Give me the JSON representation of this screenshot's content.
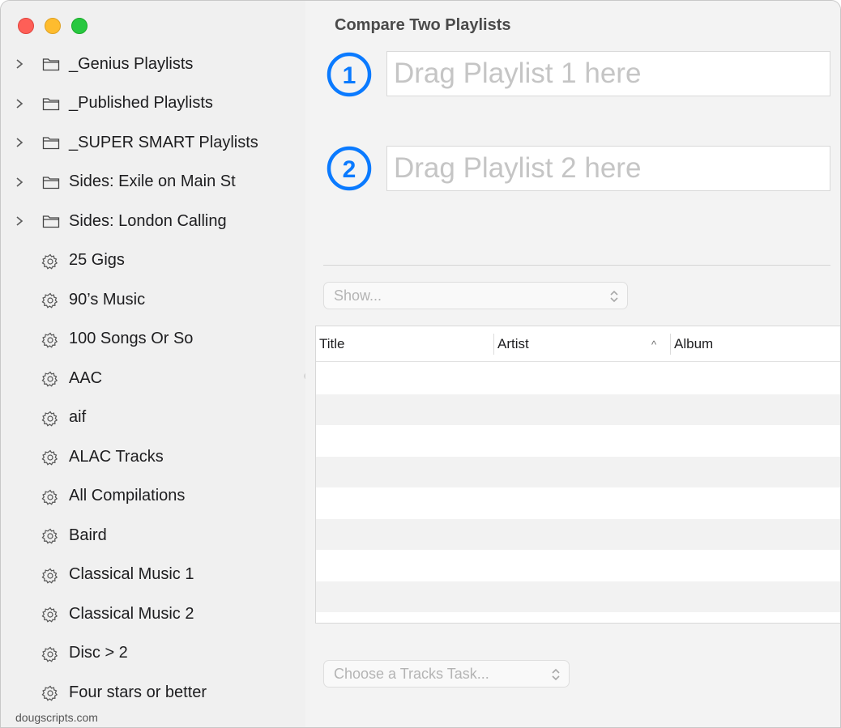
{
  "window": {
    "title": "Compare Two Playlists"
  },
  "sidebar": {
    "items": [
      {
        "label": "_Genius Playlists",
        "type": "folder"
      },
      {
        "label": "_Published Playlists",
        "type": "folder"
      },
      {
        "label": "_SUPER SMART Playlists",
        "type": "folder"
      },
      {
        "label": "Sides: Exile on Main St",
        "type": "folder"
      },
      {
        "label": "Sides: London Calling",
        "type": "folder"
      },
      {
        "label": "25 Gigs",
        "type": "smart"
      },
      {
        "label": "90’s Music",
        "type": "smart"
      },
      {
        "label": "100 Songs Or So",
        "type": "smart"
      },
      {
        "label": "AAC",
        "type": "smart"
      },
      {
        "label": "aif",
        "type": "smart"
      },
      {
        "label": "ALAC Tracks",
        "type": "smart"
      },
      {
        "label": "All Compilations",
        "type": "smart"
      },
      {
        "label": "Baird",
        "type": "smart"
      },
      {
        "label": "Classical Music 1",
        "type": "smart"
      },
      {
        "label": "Classical Music 2",
        "type": "smart"
      },
      {
        "label": "Disc > 2",
        "type": "smart"
      },
      {
        "label": "Four stars or better",
        "type": "smart"
      }
    ],
    "footer": "dougscripts.com"
  },
  "drop": {
    "badge1": "1",
    "badge2": "2",
    "placeholder1": "Drag Playlist 1 here",
    "placeholder2": "Drag Playlist 2 here"
  },
  "show_popup": {
    "value": "Show..."
  },
  "table": {
    "columns": [
      "Title",
      "Artist",
      "Album"
    ],
    "sort_indicator": "^"
  },
  "task_popup": {
    "value": "Choose a Tracks Task..."
  },
  "colors": {
    "accent": "#0a7aff",
    "close": "#fe5f57",
    "minimize": "#febc2e",
    "zoom": "#28c840"
  }
}
